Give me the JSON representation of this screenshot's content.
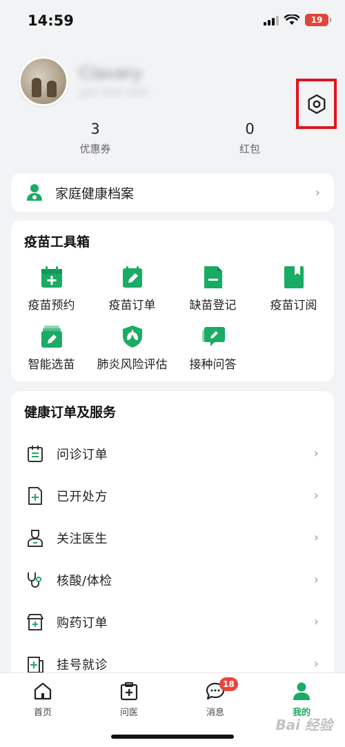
{
  "status_bar": {
    "time": "14:59",
    "battery": "19"
  },
  "profile": {
    "user_name": "Clavary",
    "user_sub": "1** **** ****"
  },
  "stats": [
    {
      "value": "3",
      "label": "优惠券"
    },
    {
      "value": "0",
      "label": "红包"
    }
  ],
  "family_record": {
    "label": "家庭健康档案"
  },
  "toolbox": {
    "title": "疫苗工具箱",
    "items": [
      {
        "label": "疫苗预约",
        "icon": "calendar-plus-icon"
      },
      {
        "label": "疫苗订单",
        "icon": "order-edit-icon"
      },
      {
        "label": "缺苗登记",
        "icon": "document-minus-icon"
      },
      {
        "label": "疫苗订阅",
        "icon": "bookmark-icon"
      },
      {
        "label": "智能选苗",
        "icon": "stack-select-icon"
      },
      {
        "label": "肺炎风险评估",
        "icon": "lungs-shield-icon"
      },
      {
        "label": "接种问答",
        "icon": "chat-qa-icon"
      }
    ]
  },
  "services": {
    "title": "健康订单及服务",
    "items": [
      {
        "label": "问诊订单",
        "icon": "clipboard-icon"
      },
      {
        "label": "已开处方",
        "icon": "prescription-icon"
      },
      {
        "label": "关注医生",
        "icon": "doctor-icon"
      },
      {
        "label": "核酸/体检",
        "icon": "stethoscope-icon"
      },
      {
        "label": "购药订单",
        "icon": "pharmacy-icon"
      },
      {
        "label": "挂号就诊",
        "icon": "registration-icon"
      }
    ]
  },
  "bottom_nav": {
    "items": [
      {
        "label": "首页",
        "icon": "home-icon"
      },
      {
        "label": "问医",
        "icon": "medical-kit-icon"
      },
      {
        "label": "消息",
        "icon": "message-icon",
        "badge": "18"
      },
      {
        "label": "我的",
        "icon": "user-icon",
        "active": true
      }
    ]
  },
  "watermark": "Bai 经验",
  "colors": {
    "brand_green": "#1aab64",
    "badge_red": "#e8453c",
    "highlight_red": "#e0141e"
  }
}
